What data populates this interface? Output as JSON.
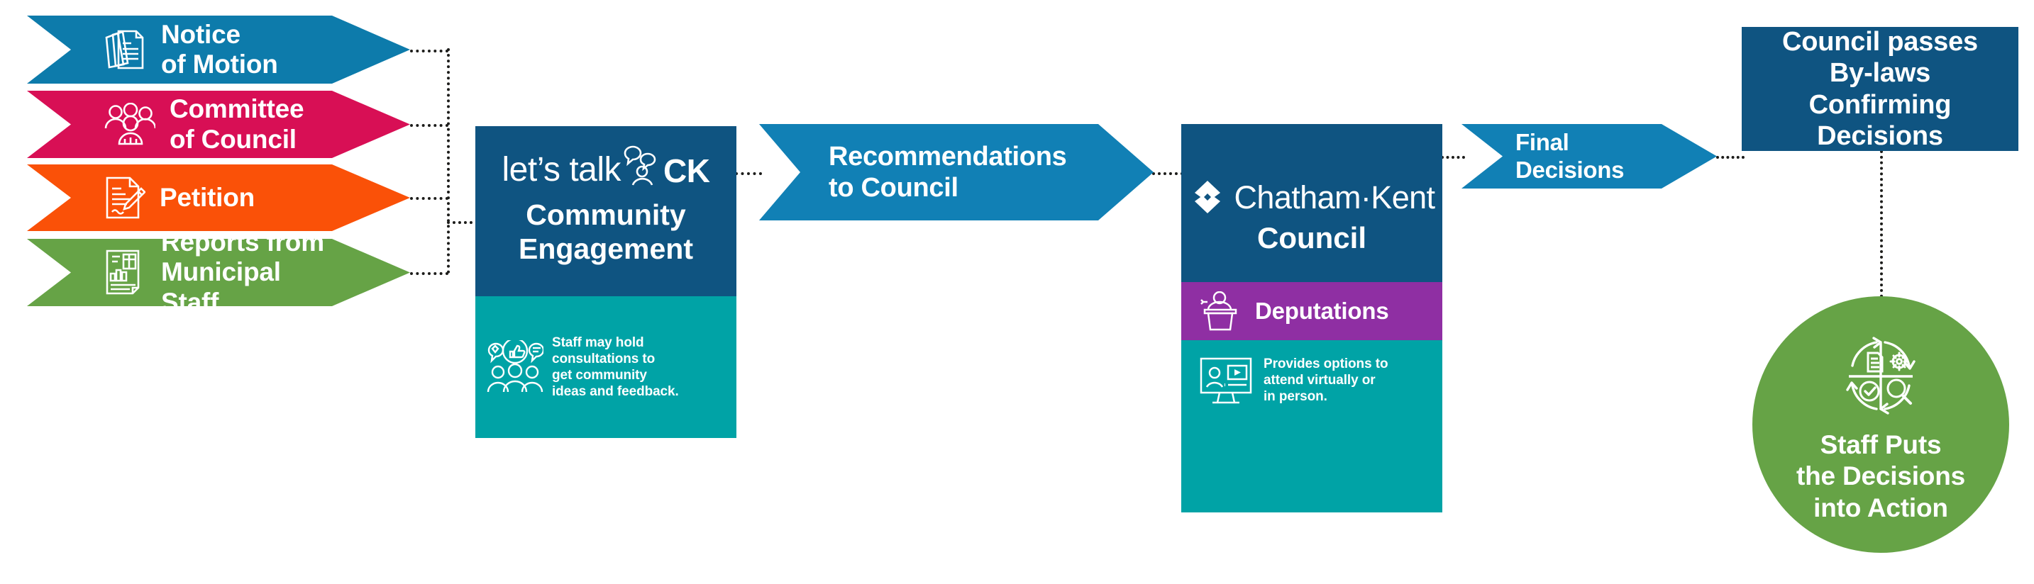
{
  "colors": {
    "blue_notice": "#0d7bab",
    "pink": "#d80f55",
    "orange": "#fa5108",
    "green": "#66a346",
    "dark_blue": "#0f5481",
    "teal": "#00a3a6",
    "purple": "#8f2fa3",
    "arrow_blue": "#1180b5",
    "bylaw_blue": "#0f5481",
    "circle_green": "#66a346",
    "connector": "#1d1d1b",
    "white": "#ffffff"
  },
  "inputs": {
    "items": [
      {
        "label": "Notice\nof Motion",
        "icon": "documents-stack-icon",
        "color_key": "blue_notice"
      },
      {
        "label": "Committee\nof Council",
        "icon": "group-of-people-icon",
        "color_key": "pink"
      },
      {
        "label": "Petition",
        "icon": "document-with-pen-icon",
        "color_key": "orange"
      },
      {
        "label": "Reports from\nMunicipal\nStaff",
        "icon": "report-chart-document-icon",
        "color_key": "green"
      }
    ]
  },
  "engagement": {
    "logo_text_left": "let’s talk",
    "logo_text_right": "CK",
    "logo_icon": "speech-bubbles-person-icon",
    "title": "Community\nEngagement",
    "note_icon": "feedback-community-icon",
    "note": "Staff may hold\nconsultations to\nget community\nideas and feedback."
  },
  "recommendations_arrow": {
    "label": "Recommendations\nto Council"
  },
  "council": {
    "logo_icon": "chatham-kent-diamond-logo",
    "logo_name": "Chatham·Kent",
    "title": "Council",
    "deputations": {
      "icon": "podium-speaker-icon",
      "label": "Deputations"
    },
    "virtual": {
      "icon": "monitor-video-call-icon",
      "note": "Provides options to\nattend virtually or\nin person."
    }
  },
  "final_arrow": {
    "label": "Final\nDecisions"
  },
  "bylaws": {
    "label": "Council passes\nBy-laws\nConfirming\nDecisions"
  },
  "action_circle": {
    "icon": "process-cycle-gear-check-search-icon",
    "label": "Staff Puts\nthe Decisions\ninto Action"
  }
}
